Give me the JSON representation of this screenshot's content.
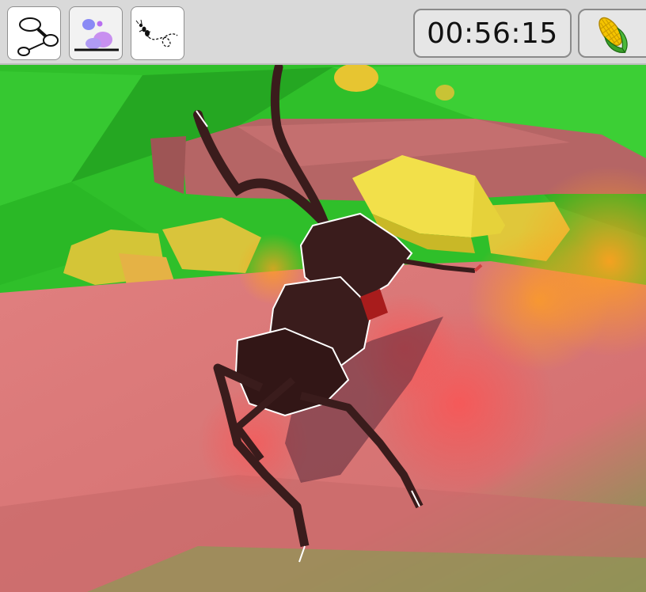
{
  "hud": {
    "timer": "00:56:15",
    "tools": [
      {
        "icon": "network-graph-icon",
        "selected": false
      },
      {
        "icon": "scent-blob-icon",
        "selected": true
      },
      {
        "icon": "ant-trail-icon",
        "selected": false
      }
    ],
    "resource_icon": "corn-icon"
  },
  "scene": {
    "colors": {
      "grass": "#2fbf2a",
      "ground": "#d87a7a",
      "ant_body": "#3a1c1c",
      "food": "#f2e04a",
      "pheromone_orange": "#ffa020"
    }
  }
}
